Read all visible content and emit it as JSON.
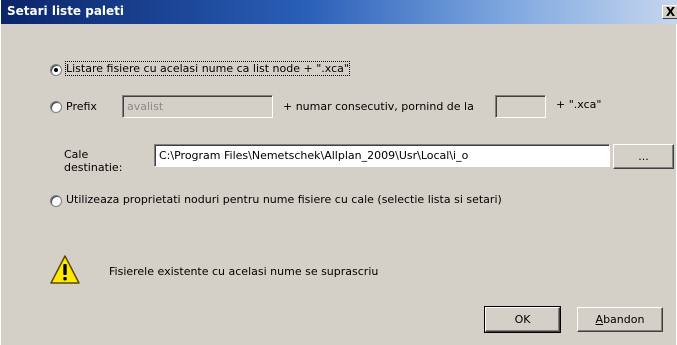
{
  "window": {
    "title": "Setari liste paleti",
    "close_glyph": "X"
  },
  "options": {
    "option1_label": "Listare fisiere cu acelasi nume ca list node + \".xca\"",
    "option2_label": "Prefix",
    "prefix_value": "avalist",
    "numbering_label": "+ numar consecutiv, pornind de la",
    "start_number_value": "",
    "extension_label": "+ \".xca\"",
    "option3_label": "Utilizeaza proprietati noduri pentru nume fisiere cu cale (selectie lista si setari)",
    "selected_option": 1
  },
  "destination": {
    "label_line1": "Cale",
    "label_line2": "destinatie:",
    "path_value": "C:\\Program Files\\Nemetschek\\Allplan_2009\\Usr\\Local\\i_o",
    "browse_label": "..."
  },
  "warning": {
    "icon": "warning-icon",
    "text": "Fisierele existente cu acelasi nume se suprascriu"
  },
  "buttons": {
    "ok_label": "OK",
    "cancel_label_prefix": "A",
    "cancel_label_rest": "bandon"
  },
  "colors": {
    "titlebar_start": "#0a246a",
    "dialog_bg": "#d4d0c8",
    "warning_yellow": "#ffe800"
  }
}
